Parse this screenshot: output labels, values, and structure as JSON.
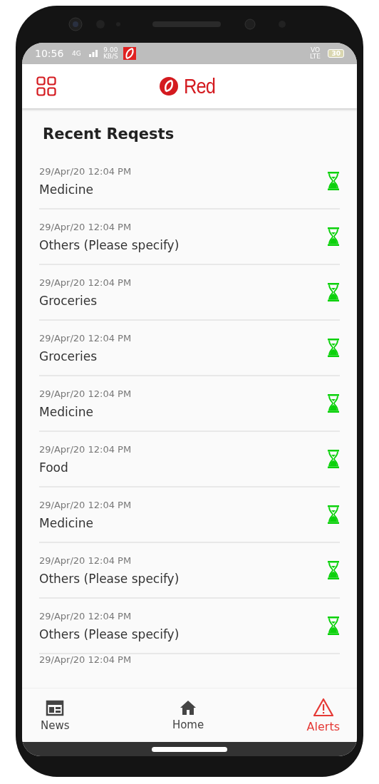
{
  "status_bar": {
    "time": "10:56",
    "network": "4G",
    "speed": "9.00 KB/S",
    "volte": "VO LTE",
    "battery": "30"
  },
  "header": {
    "logo": "Red"
  },
  "title": "Recent Reqests",
  "requests": [
    {
      "date": "29/Apr/20 12:04 PM",
      "name": "Medicine",
      "pending": true
    },
    {
      "date": "29/Apr/20 12:04 PM",
      "name": "Others (Please specify)",
      "pending": true
    },
    {
      "date": "29/Apr/20 12:04 PM",
      "name": "Groceries",
      "pending": true
    },
    {
      "date": "29/Apr/20 12:04 PM",
      "name": "Groceries",
      "pending": true
    },
    {
      "date": "29/Apr/20 12:04 PM",
      "name": "Medicine",
      "pending": true
    },
    {
      "date": "29/Apr/20 12:04 PM",
      "name": "Food",
      "pending": true
    },
    {
      "date": "29/Apr/20 12:04 PM",
      "name": "Medicine",
      "pending": true
    },
    {
      "date": "29/Apr/20 12:04 PM",
      "name": "Others (Please specify)",
      "pending": true
    },
    {
      "date": "29/Apr/20 12:04 PM",
      "name": "Others (Please specify)",
      "pending": true
    },
    {
      "date": "29/Apr/20 12:04 PM"
    }
  ],
  "nav": [
    {
      "label": "News",
      "kind": "news",
      "selected": false
    },
    {
      "label": "Home",
      "kind": "home",
      "selected": false
    },
    {
      "label": "Alerts",
      "kind": "alert",
      "selected": true
    }
  ]
}
